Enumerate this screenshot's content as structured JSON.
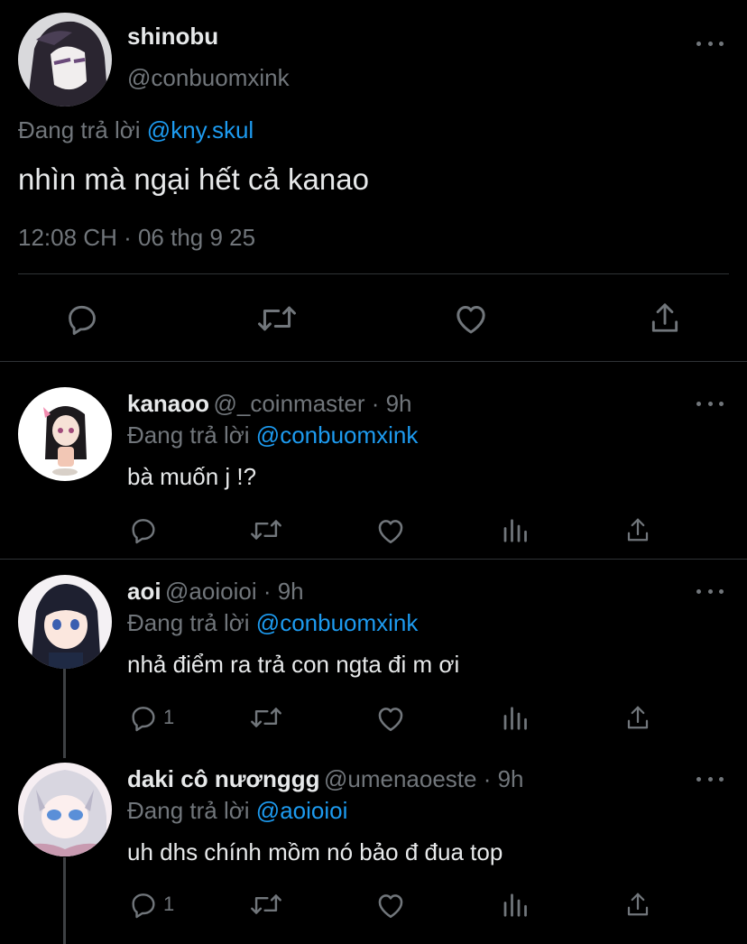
{
  "main_tweet": {
    "display_name": "shinobu",
    "handle": "@conbuomxink",
    "replying_prefix": "Đang trả lời",
    "replying_to": "@kny.skul",
    "text": "nhìn mà ngại hết cả kanao",
    "timestamp": "12:08 CH · 06 thg 9 25"
  },
  "replies": [
    {
      "display_name": "kanaoo",
      "handle": "@_coinmaster · 9h",
      "replying_prefix": "Đang trả lời",
      "replying_to": "@conbuomxink",
      "text": "bà muốn j !?",
      "reply_count": ""
    },
    {
      "display_name": "aoi",
      "handle": "@aoioioi · 9h",
      "replying_prefix": "Đang trả lời",
      "replying_to": "@conbuomxink",
      "text": "nhả điểm ra trả con ngta đi m ơi",
      "reply_count": "1"
    },
    {
      "display_name": "daki cô nươnggg",
      "handle": "@umenaoeste · 9h",
      "replying_prefix": "Đang trả lời",
      "replying_to": "@aoioioi",
      "text": "uh dhs chính mồm nó bảo đ đua top",
      "reply_count": "1"
    }
  ],
  "icons": [
    "reply-icon",
    "retweet-icon",
    "like-icon",
    "analytics-icon",
    "share-icon",
    "more-icon"
  ],
  "colors": {
    "background": "#000000",
    "text": "#e7e9ea",
    "muted": "#71767b",
    "link": "#1d9bf0",
    "divider": "#2f3336"
  }
}
